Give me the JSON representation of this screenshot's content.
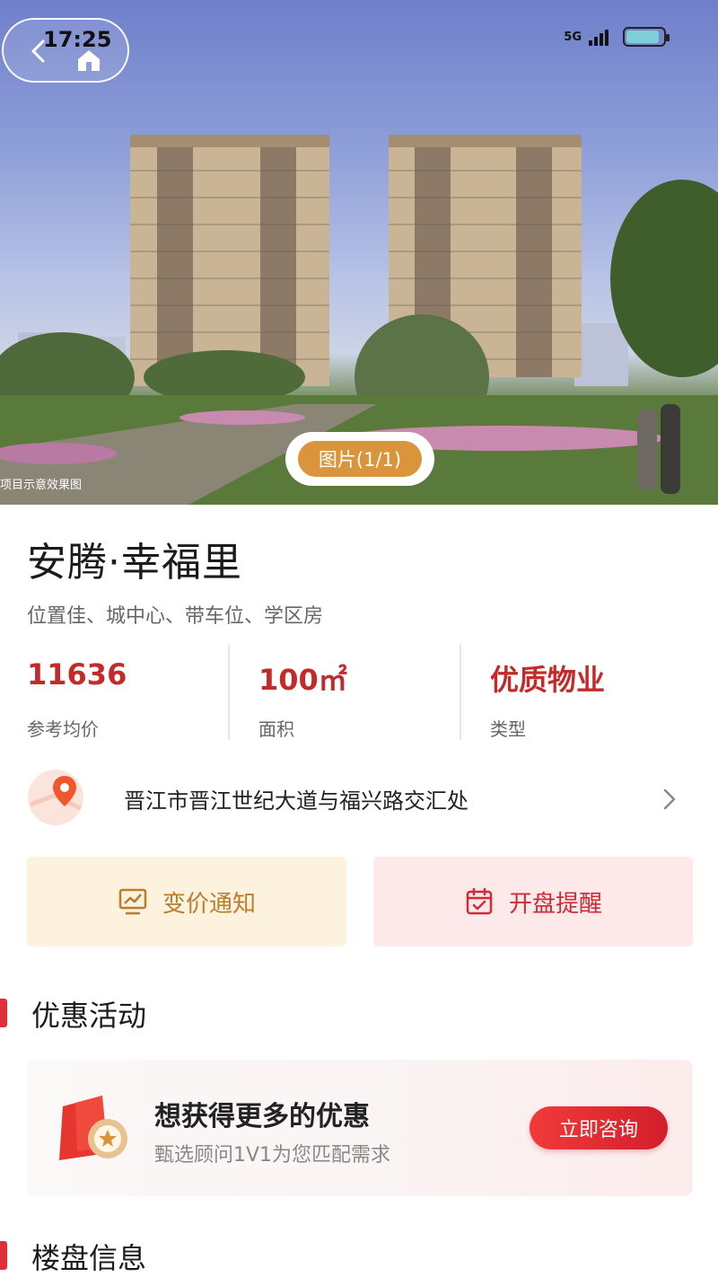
{
  "status_bar": {
    "time": "17:25",
    "network": "5G"
  },
  "hero": {
    "photo_counter": "图片(1/1)",
    "photo_caption": "项目示意效果图"
  },
  "property": {
    "name": "安腾·幸福里",
    "tags": "位置佳、城中心、带车位、学区房"
  },
  "stats": [
    {
      "value": "11636",
      "label": "参考均价"
    },
    {
      "value": "100㎡",
      "label": "面积"
    },
    {
      "value": "优质物业",
      "label": "类型"
    }
  ],
  "address": {
    "text": "晋江市晋江世纪大道与福兴路交汇处"
  },
  "actions": {
    "price_alert": "变价通知",
    "opening_reminder": "开盘提醒"
  },
  "sections": {
    "promotions_title": "优惠活动",
    "building_info_title": "楼盘信息"
  },
  "promo": {
    "title": "想获得更多的优惠",
    "subtitle": "甄选顾问1V1为您匹配需求",
    "button": "立即咨询"
  },
  "colors": {
    "accent_red": "#c52a2a",
    "section_bar": "#e0303a",
    "photo_badge": "#d9943c",
    "price_alert_bg": "#fdf2dd",
    "opening_bg": "#fde8ea"
  }
}
